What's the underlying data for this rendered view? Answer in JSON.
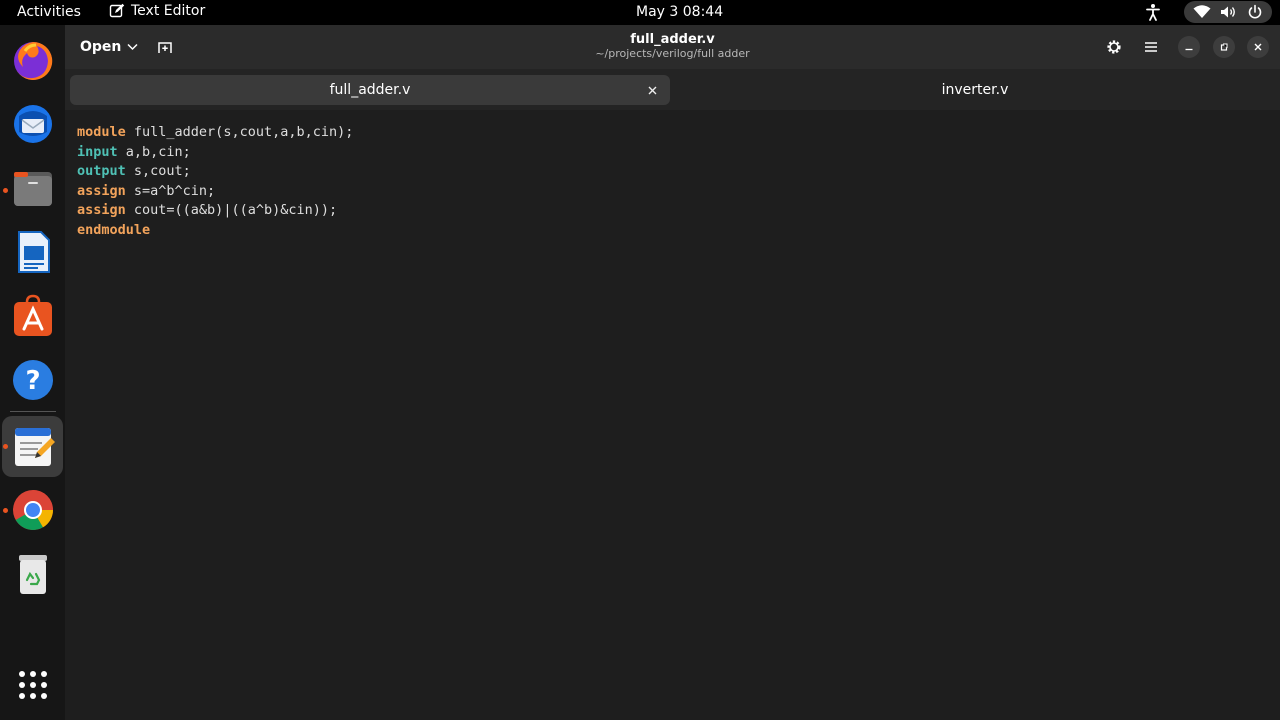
{
  "topbar": {
    "activities": "Activities",
    "app_name": "Text Editor",
    "clock": "May 3  08:44"
  },
  "dock": {
    "items": [
      "firefox-icon",
      "thunderbird-icon",
      "files-icon",
      "writer-icon",
      "app-center-icon",
      "help-icon",
      "text-editor-icon",
      "chrome-icon",
      "trash-icon",
      "app-grid-icon"
    ]
  },
  "window": {
    "open_label": "Open",
    "title": "full_adder.v",
    "subtitle": "~/projects/verilog/full adder"
  },
  "tabs": [
    {
      "label": "full_adder.v",
      "active": true
    },
    {
      "label": "inverter.v",
      "active": false
    }
  ],
  "editor": {
    "lines": [
      {
        "kw": "module",
        "rest": " full_adder(s,cout,a,b,cin);"
      },
      {
        "kw": "input",
        "rest": " a,b,cin;"
      },
      {
        "kw": "output",
        "rest": " s,cout;"
      },
      {
        "kw": "assign",
        "rest": " s=a^b^cin;"
      },
      {
        "kw": "assign",
        "rest": " cout=((a&b)|((a^b)&cin));"
      },
      {
        "kw": "endmodule",
        "rest": ""
      }
    ]
  },
  "colors": {
    "keyword_orange": "#f2a35b",
    "keyword_teal": "#4fc1b5",
    "accent": "#e95420"
  }
}
